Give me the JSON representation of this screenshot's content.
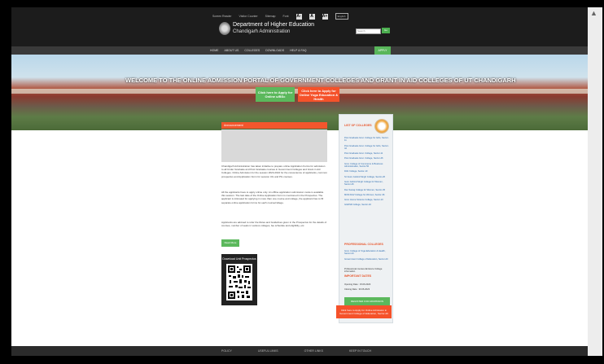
{
  "utility_bar": {
    "links": [
      "Screen Reader",
      "Visitor Counter",
      "Sitemap",
      "Font"
    ],
    "font_buttons": [
      "A-",
      "A",
      "A+"
    ],
    "language": "English"
  },
  "header": {
    "department": "Department of Higher Education",
    "administration": "Chandigarh Administration",
    "search_placeholder": "Search",
    "search_button": "Go"
  },
  "nav": {
    "items": [
      "HOME",
      "ABOUT US",
      "COLLEGES",
      "DOWNLOADS",
      "HELP & FAQ"
    ],
    "apply_link": "APPLY NOW"
  },
  "hero": {
    "title": "WELCOME TO THE ONLINE ADMISSION PORTAL OF GOVERNMENT COLLEGES AND GRANT IN AID COLLEGES OF UT CHANDIGARH",
    "btn_online": "Click here to Apply for Online u/BSc",
    "btn_yoga": "Click here to Apply for Online Yoga Education & Health"
  },
  "announcements": {
    "title": "Announcement"
  },
  "content": {
    "p1": "Chandigarh Administration has taken initiative to prepare online Application Forms for admission to all Under Graduate and Post Graduate courses in Government Colleges and Grant in Aid Colleges. Online Admission for the session 2023-2024 for the convenience of applicants, common prospectus and Application Form for session UG and PG courses.",
    "p2": "All the applicants have to apply online only. An offline application submission mode is available this session. The last date of the Online Application Form is mentioned in the Prospectus. The applicant is intimated for applying in more than one course and college, the applicant has to fill separate online application forms for each course/college.",
    "p3": "Applicants are advised to refer the Rules and Guidelines given in the Prospectus for the details of courses, number of seats in various colleges, fee schedule and eligibility, etc.",
    "read_more": "Read More"
  },
  "prospectus": {
    "title": "Download Unit Prospectus"
  },
  "sidebar": {
    "title": "LIST OF COLLEGES",
    "colleges": [
      "Post Graduate Govt. College for Girls, Sector-11",
      "Post Graduate Govt. College for Girls, Sector-42",
      "Post Graduate Govt. College, Sector-11",
      "Post Graduate Govt. College, Sector-46",
      "Govt. College of Commerce & Business Administration, Sector-50",
      "DAV College, Sector-10",
      "Sri Guru Gobind Singh College, Sector-26",
      "Guru Gobind Singh College for Women, Sector-26",
      "Dev Samaj College for Women, Sector-45",
      "MCM DAV College for Women, Sector-36",
      "Govt. Home Science College, Sector-10",
      "GGDSD College, Sector-32"
    ],
    "professional_title": "PROFESSIONAL COLLEGES",
    "professional": [
      "Govt. College of Yoga Education & Health, Sector-23",
      "Government College of Education, Sector-20"
    ],
    "professional_note": "Professional courses Entrance College information",
    "dates_title": "IMPORTANT DATES",
    "opening_date": "Opening Date : 15.06.2023",
    "closing_date": "Closing Date : 30.06.2023",
    "green_button": "REGISTER FOR ADMISSION",
    "orange_button": "Click here to Apply for Online Admission in Government College of Education, Sector-20"
  },
  "footer": {
    "links": [
      "POLICY",
      "USEFUL LINKS",
      "OTHER LINKS",
      "KEEP IN TOUCH"
    ]
  }
}
